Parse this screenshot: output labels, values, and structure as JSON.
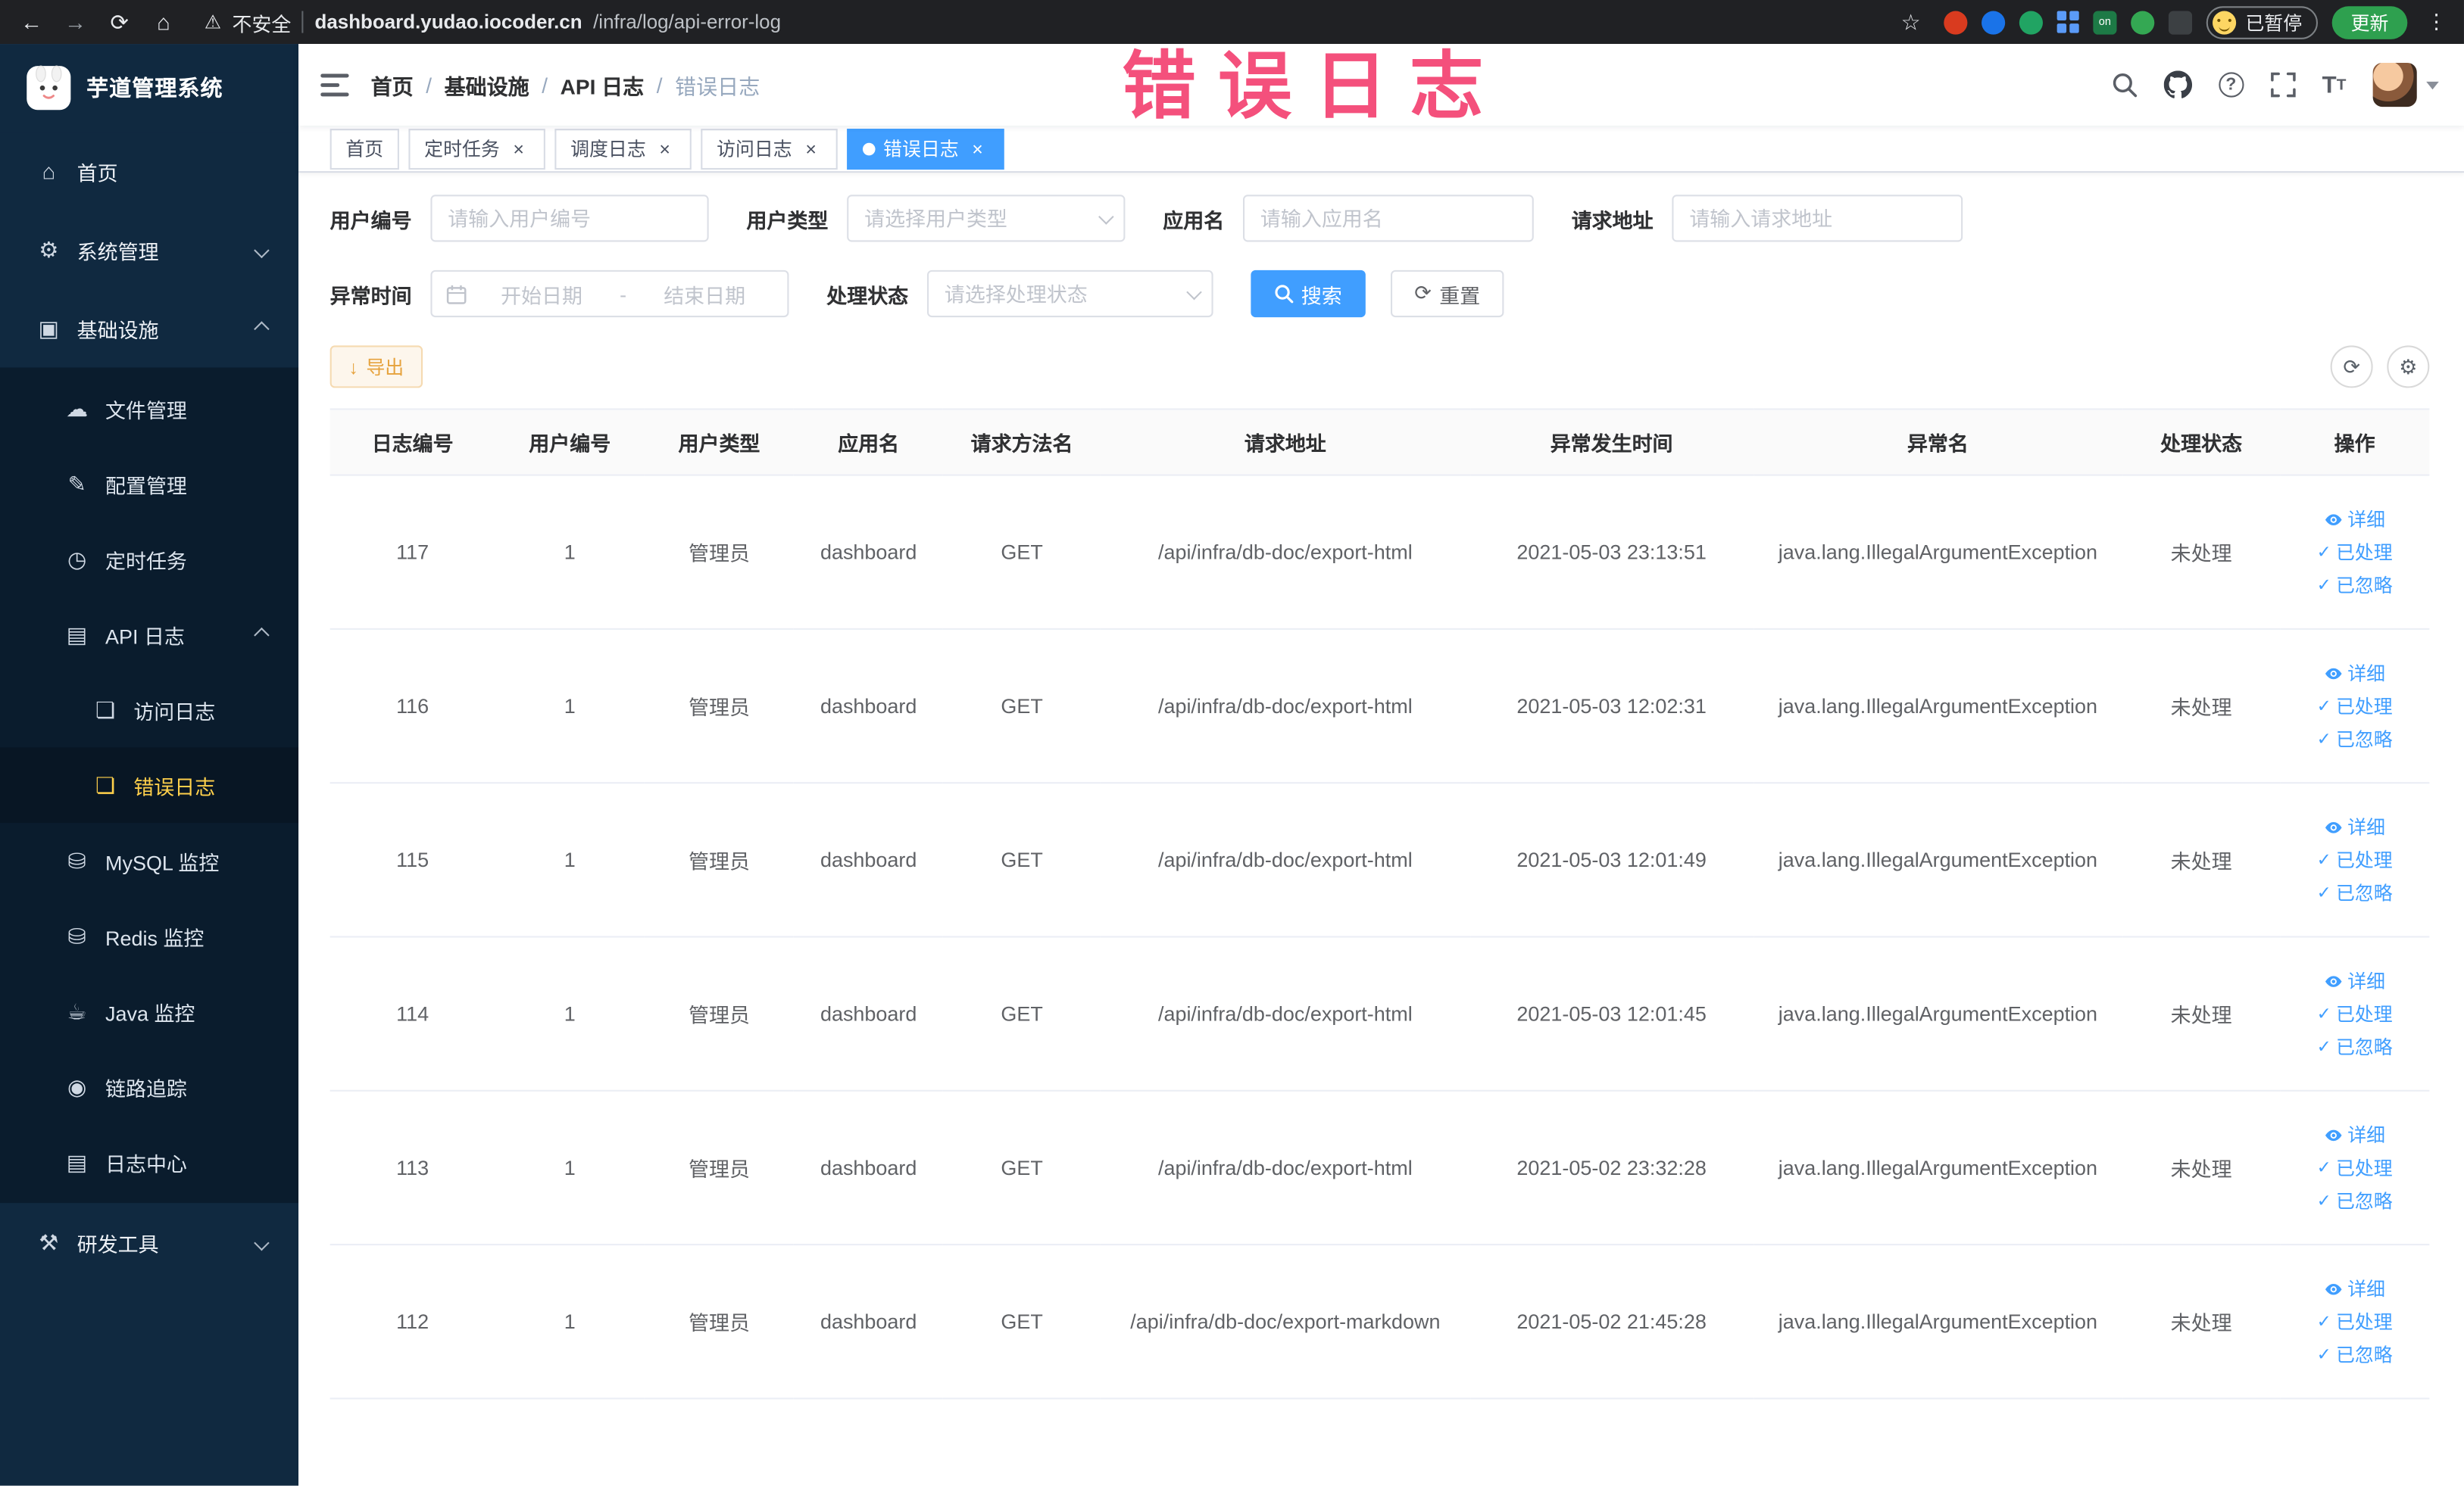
{
  "colors": {
    "accent": "#409eff",
    "menu_active_text": "#ffd04b",
    "watermark_pink": "#f4507c",
    "export_orange": "#e6a23c",
    "tab_active": "#409eff"
  },
  "watermark": "错误日志",
  "browser": {
    "security": "不安全",
    "url_host": "dashboard.yudao.iocoder.cn",
    "url_path": "/infra/log/api-error-log",
    "ext_on": "on",
    "paused": "已暂停",
    "update": "更新"
  },
  "icons": {
    "back": "←",
    "forward": "→",
    "reload": "⟳",
    "home": "⌂",
    "warning": "⚠",
    "star": "☆",
    "dots": "⋮",
    "menu_home": "⌂",
    "menu_system": "⚙",
    "menu_infra": "▣",
    "menu_file": "☁",
    "menu_config": "✎",
    "menu_job": "◷",
    "menu_apilog": "▤",
    "menu_access": "❏",
    "menu_error": "❏",
    "menu_mysql": "⛁",
    "menu_redis": "⛁",
    "menu_java": "☕",
    "menu_trace": "◉",
    "menu_logcenter": "▤",
    "menu_devtools": "⚒",
    "help": "?",
    "refresh": "⟳",
    "gear": "⚙",
    "download": "↓",
    "check": "✓",
    "textsize": "T"
  },
  "sidebar": {
    "title": "芋道管理系统",
    "items": [
      {
        "label": "首页"
      },
      {
        "label": "系统管理"
      },
      {
        "label": "基础设施"
      },
      {
        "label": "文件管理"
      },
      {
        "label": "配置管理"
      },
      {
        "label": "定时任务"
      },
      {
        "label": "API 日志"
      },
      {
        "label": "访问日志"
      },
      {
        "label": "错误日志"
      },
      {
        "label": "MySQL 监控"
      },
      {
        "label": "Redis 监控"
      },
      {
        "label": "Java 监控"
      },
      {
        "label": "链路追踪"
      },
      {
        "label": "日志中心"
      },
      {
        "label": "研发工具"
      }
    ]
  },
  "breadcrumb": [
    "首页",
    "基础设施",
    "API 日志",
    "错误日志"
  ],
  "tabs": [
    {
      "label": "首页"
    },
    {
      "label": "定时任务"
    },
    {
      "label": "调度日志"
    },
    {
      "label": "访问日志"
    },
    {
      "label": "错误日志"
    }
  ],
  "filters": {
    "user_id_label": "用户编号",
    "user_id_placeholder": "请输入用户编号",
    "user_type_label": "用户类型",
    "user_type_placeholder": "请选择用户类型",
    "app_label": "应用名",
    "app_placeholder": "请输入应用名",
    "url_label": "请求地址",
    "url_placeholder": "请输入请求地址",
    "time_label": "异常时间",
    "time_start": "开始日期",
    "time_sep": "-",
    "time_end": "结束日期",
    "status_label": "处理状态",
    "status_placeholder": "请选择处理状态",
    "search": "搜索",
    "reset": "重置"
  },
  "toolbar": {
    "export": "导出"
  },
  "table": {
    "columns": [
      "日志编号",
      "用户编号",
      "用户类型",
      "应用名",
      "请求方法名",
      "请求地址",
      "异常发生时间",
      "异常名",
      "处理状态",
      "操作"
    ],
    "actions": [
      "详细",
      "已处理",
      "已忽略"
    ],
    "rows": [
      {
        "id": "117",
        "uid": "1",
        "utype": "管理员",
        "app": "dashboard",
        "method": "GET",
        "url": "/api/infra/db-doc/export-html",
        "time": "2021-05-03 23:13:51",
        "exc": "java.lang.IllegalArgumentException",
        "status": "未处理"
      },
      {
        "id": "116",
        "uid": "1",
        "utype": "管理员",
        "app": "dashboard",
        "method": "GET",
        "url": "/api/infra/db-doc/export-html",
        "time": "2021-05-03 12:02:31",
        "exc": "java.lang.IllegalArgumentException",
        "status": "未处理"
      },
      {
        "id": "115",
        "uid": "1",
        "utype": "管理员",
        "app": "dashboard",
        "method": "GET",
        "url": "/api/infra/db-doc/export-html",
        "time": "2021-05-03 12:01:49",
        "exc": "java.lang.IllegalArgumentException",
        "status": "未处理"
      },
      {
        "id": "114",
        "uid": "1",
        "utype": "管理员",
        "app": "dashboard",
        "method": "GET",
        "url": "/api/infra/db-doc/export-html",
        "time": "2021-05-03 12:01:45",
        "exc": "java.lang.IllegalArgumentException",
        "status": "未处理"
      },
      {
        "id": "113",
        "uid": "1",
        "utype": "管理员",
        "app": "dashboard",
        "method": "GET",
        "url": "/api/infra/db-doc/export-html",
        "time": "2021-05-02 23:32:28",
        "exc": "java.lang.IllegalArgumentException",
        "status": "未处理"
      },
      {
        "id": "112",
        "uid": "1",
        "utype": "管理员",
        "app": "dashboard",
        "method": "GET",
        "url": "/api/infra/db-doc/export-markdown",
        "time": "2021-05-02 21:45:28",
        "exc": "java.lang.IllegalArgumentException",
        "status": "未处理"
      }
    ]
  }
}
